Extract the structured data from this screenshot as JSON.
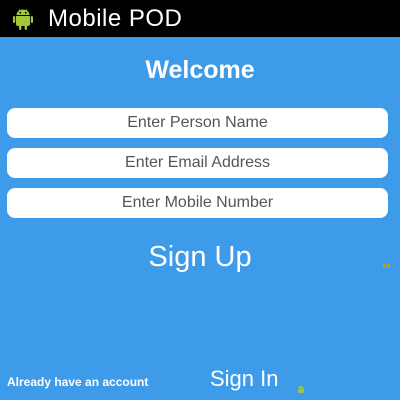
{
  "titlebar": {
    "title": "Mobile POD",
    "icon": "android-icon"
  },
  "form": {
    "heading": "Welcome",
    "name_placeholder": "Enter Person Name",
    "email_placeholder": "Enter Email Address",
    "mobile_placeholder": "Enter Mobile Number",
    "signup_label": "Sign Up"
  },
  "footer": {
    "prompt": "Already have an account",
    "signin_label": "Sign In"
  },
  "colors": {
    "background": "#3d9be9",
    "titlebar": "#000000",
    "field": "#ffffff",
    "text": "#ffffff",
    "android": "#a4c639"
  }
}
